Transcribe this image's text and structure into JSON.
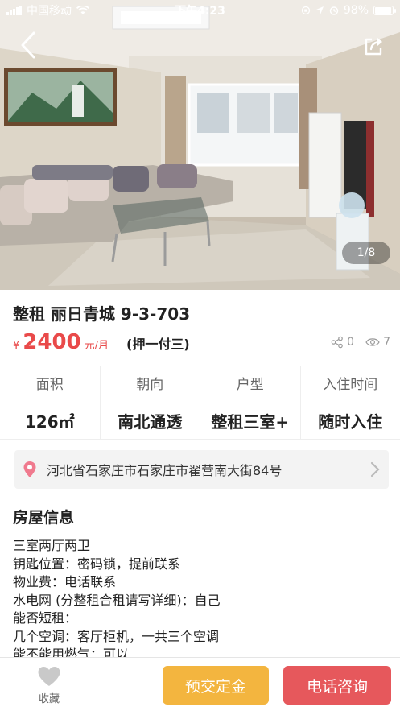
{
  "status_bar": {
    "carrier": "中国移动",
    "time": "下午4:23",
    "battery": "98%"
  },
  "gallery": {
    "counter": "1/8",
    "icons": [
      "back-icon",
      "share-icon"
    ]
  },
  "listing": {
    "title": "整租 丽日青城 9-3-703",
    "price_symbol": "¥",
    "price": "2400",
    "price_unit": "元/月",
    "deposit_terms": "(押一付三)",
    "shares": "0",
    "views": "7"
  },
  "specs": [
    {
      "label": "面积",
      "value": "126㎡"
    },
    {
      "label": "朝向",
      "value": "南北通透"
    },
    {
      "label": "户型",
      "value": "整租三室+"
    },
    {
      "label": "入住时间",
      "value": "随时入住"
    }
  ],
  "address": {
    "text": "河北省石家庄市石家庄市翟营南大街84号"
  },
  "house_info": {
    "title": "房屋信息",
    "lines": [
      "三室两厅两卫",
      "钥匙位置：密码锁，提前联系",
      "物业费：电话联系",
      "水电网 (分整租合租请写详细)：自己",
      "能否短租：",
      "几个空调：客厅柜机，一共三个空调",
      "能不能用燃气：可以"
    ]
  },
  "bottom_bar": {
    "favorite_label": "收藏",
    "deposit_button": "预交定金",
    "call_button": "电话咨询"
  },
  "colors": {
    "price": "#e94a4a",
    "deposit_button": "#f3b53f",
    "call_button": "#e6585c"
  }
}
